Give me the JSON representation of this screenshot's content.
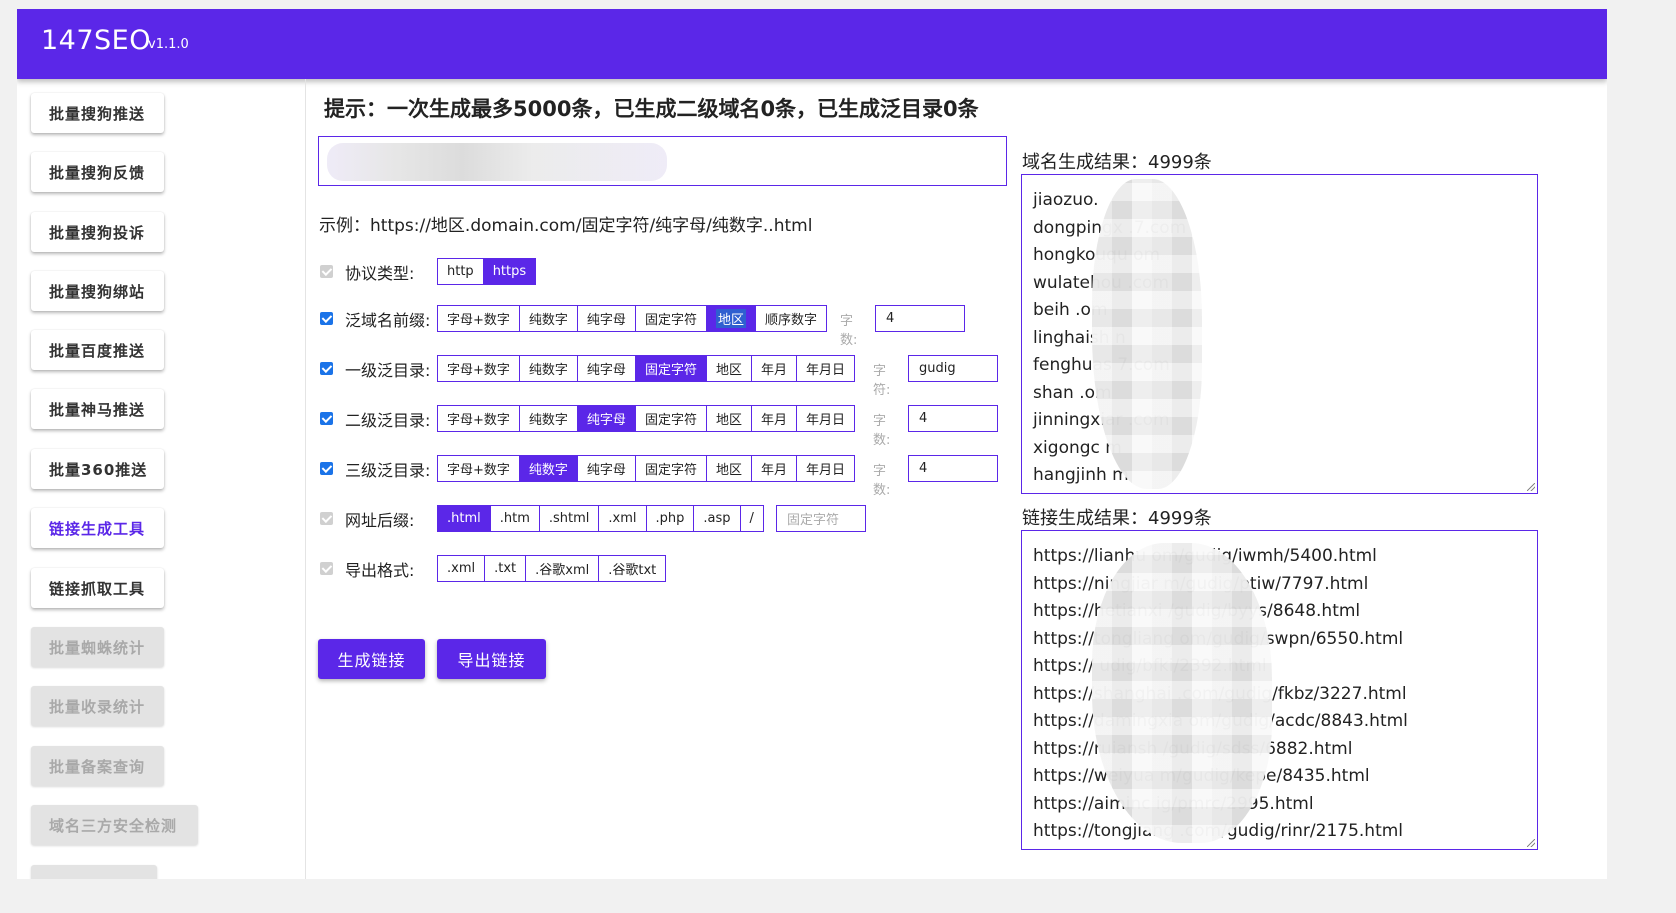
{
  "header": {
    "brand": "147SEO",
    "version": "v1.1.0"
  },
  "sidebar": {
    "items": [
      {
        "label": "批量搜狗推送",
        "state": "normal"
      },
      {
        "label": "批量搜狗反馈",
        "state": "normal"
      },
      {
        "label": "批量搜狗投诉",
        "state": "normal"
      },
      {
        "label": "批量搜狗绑站",
        "state": "normal"
      },
      {
        "label": "批量百度推送",
        "state": "normal"
      },
      {
        "label": "批量神马推送",
        "state": "normal"
      },
      {
        "label": "批量360推送",
        "state": "normal"
      },
      {
        "label": "链接生成工具",
        "state": "active"
      },
      {
        "label": "链接抓取工具",
        "state": "normal"
      },
      {
        "label": "批量蜘蛛统计",
        "state": "disabled"
      },
      {
        "label": "批量收录统计",
        "state": "disabled"
      },
      {
        "label": "批量备案查询",
        "state": "disabled"
      },
      {
        "label": "域名三方安全检测",
        "state": "disabled"
      }
    ]
  },
  "main": {
    "tip": "提示：一次生成最多5000条，已生成二级域名0条，已生成泛目录0条",
    "example": "示例：https://地区.domain.com/固定字符/纯字母/纯数字..html",
    "protocol": {
      "label": "协议类型:",
      "checked": true,
      "options": [
        "http",
        "https"
      ],
      "selected": "https"
    },
    "prefix": {
      "label": "泛域名前缀:",
      "checked": true,
      "options": [
        "字母+数字",
        "纯数字",
        "纯字母",
        "固定字符",
        "地区",
        "顺序数字"
      ],
      "selected": "地区",
      "count_label": "字数:",
      "count_value": "4"
    },
    "dir1": {
      "label": "一级泛目录:",
      "checked": true,
      "options": [
        "字母+数字",
        "纯数字",
        "纯字母",
        "固定字符",
        "地区",
        "年月",
        "年月日"
      ],
      "selected": "固定字符",
      "count_label": "字符:",
      "count_value": "gudig"
    },
    "dir2": {
      "label": "二级泛目录:",
      "checked": true,
      "options": [
        "字母+数字",
        "纯数字",
        "纯字母",
        "固定字符",
        "地区",
        "年月",
        "年月日"
      ],
      "selected": "纯字母",
      "count_label": "字数:",
      "count_value": "4"
    },
    "dir3": {
      "label": "三级泛目录:",
      "checked": true,
      "options": [
        "字母+数字",
        "纯数字",
        "纯字母",
        "固定字符",
        "地区",
        "年月",
        "年月日"
      ],
      "selected": "纯数字",
      "count_label": "字数:",
      "count_value": "4"
    },
    "suffix": {
      "label": "网址后缀:",
      "checked": true,
      "options": [
        ".html",
        ".htm",
        ".shtml",
        ".xml",
        ".php",
        ".asp",
        "/"
      ],
      "selected": ".html",
      "placeholder": "固定字符"
    },
    "export": {
      "label": "导出格式:",
      "checked": true,
      "options": [
        ".xml",
        ".txt",
        ".谷歌xml",
        ".谷歌txt"
      ]
    },
    "generate_label": "生成链接",
    "export_label": "导出链接"
  },
  "results": {
    "domain_title": "域名生成结果：4999条",
    "domain_lines": [
      "jiaozuo.",
      "dongpingx .7.com",
      "hongkouqu om",
      "wulatehou .com",
      "beih .om",
      "linghaish n",
      "fenghuas 7.com",
      "shan .om",
      "jinningxiar .com",
      "xigongc m",
      "hangjinh m"
    ],
    "link_title": "链接生成结果：4999条",
    "link_lines": [
      "https://lianhu om/gudig/iwmh/5400.html",
      "https://ningjiar m/gudig/ptiw/7797.html",
      "https://hetianxi /gudig/byys/8648.html",
      "https://tongliang om/gudig/swpn/6550.html",
      "https:// udig/bfki/2392.html",
      "https://shanghai .com/gudig/fkbz/3227.html",
      "https://damingxia om/gudig/acdc/8843.html",
      "https://ruiansh /gudig/sdss/6882.html",
      "https://weiyua m/gudig/kepe/8435.html",
      "https://aiminc ig/pmrc/2995.html",
      "https://tongjiang .com/gudig/rinr/2175.html"
    ]
  },
  "colors": {
    "accent": "#5b27e8",
    "checkbox": "#1a73e8"
  }
}
